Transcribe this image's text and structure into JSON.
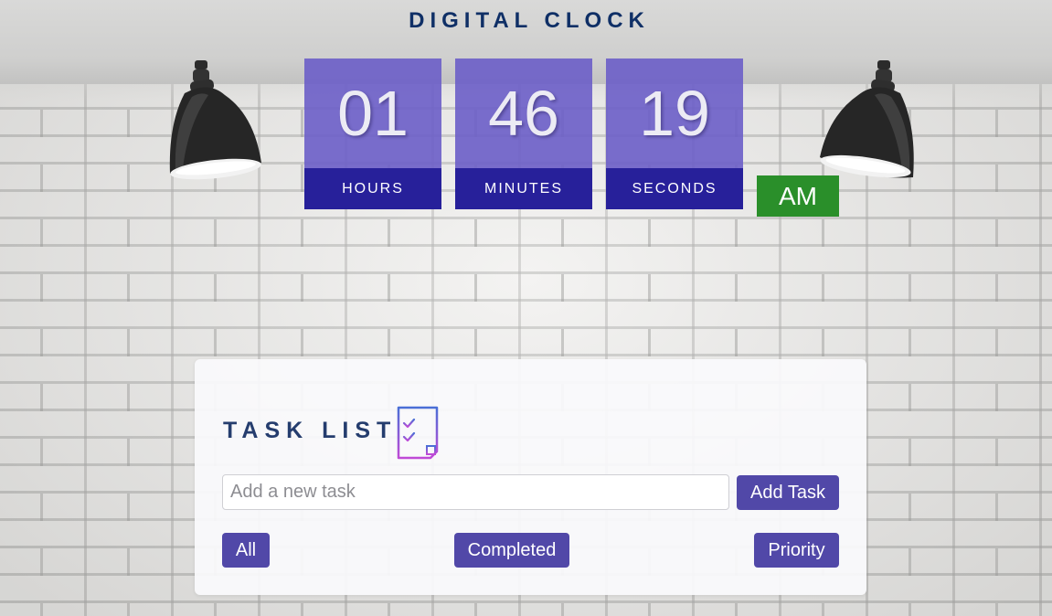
{
  "header": {
    "title": "DIGITAL CLOCK"
  },
  "clock": {
    "hours": "01",
    "minutes": "46",
    "seconds": "19",
    "hours_label": "HOURS",
    "minutes_label": "MINUTES",
    "seconds_label": "SECONDS",
    "period": "AM"
  },
  "tasks": {
    "heading": "TASK LIST",
    "input": {
      "value": "",
      "placeholder": "Add a new task"
    },
    "add_button_label": "Add Task",
    "filters": {
      "all_label": "All",
      "completed_label": "Completed",
      "priority_label": "Priority"
    }
  },
  "icons": {
    "lamp_left": "pendant-lamp-icon",
    "lamp_right": "pendant-lamp-icon",
    "task_list": "checklist-icon"
  },
  "colors": {
    "title": "#0f2f66",
    "clock_digit_bg": "#6b5ec8",
    "clock_label_bg": "#27209a",
    "period_bg": "#2a8f2a",
    "button_bg": "#5148a8",
    "task_heading": "#253d6e"
  }
}
